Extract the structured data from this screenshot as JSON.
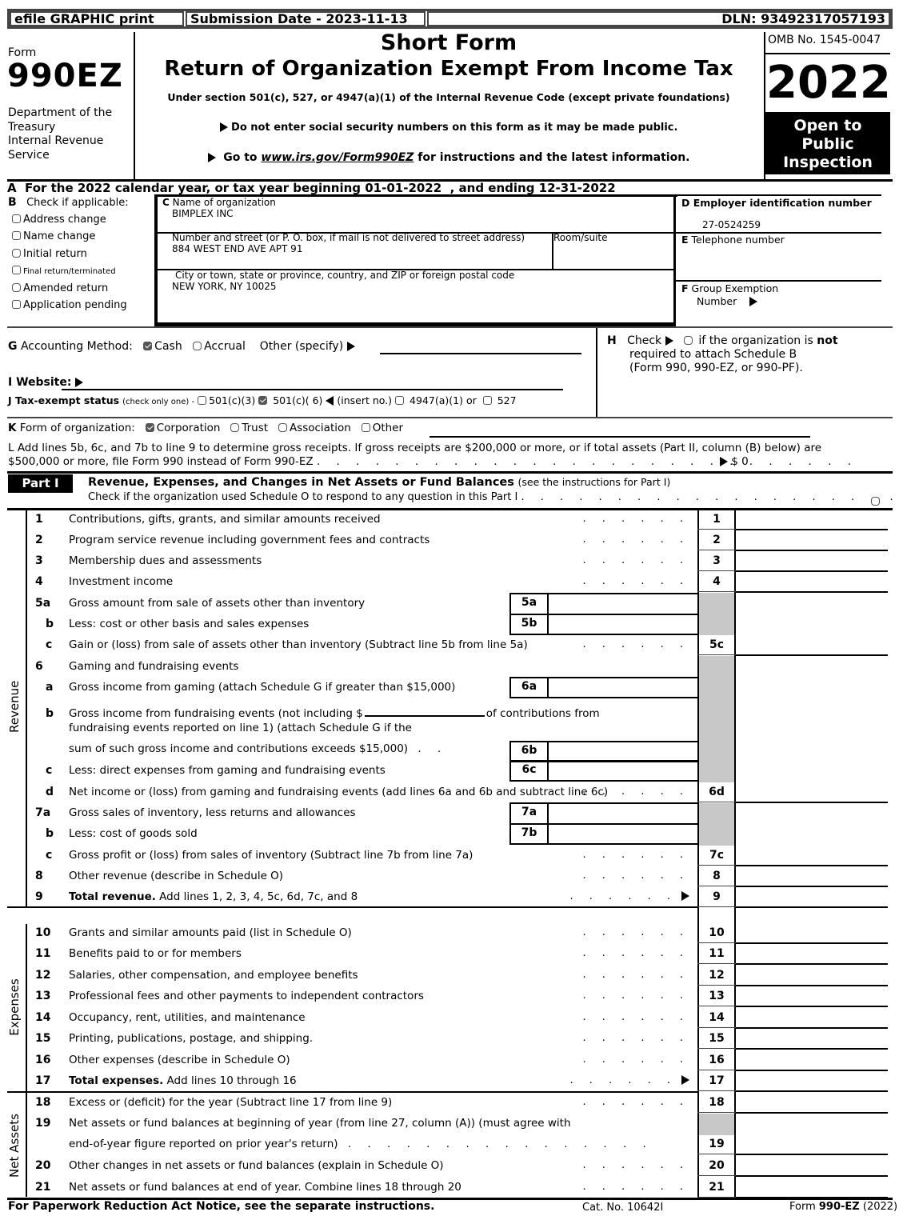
{
  "topbar": {
    "efile": "efile GRAPHIC print",
    "submission": "Submission Date - 2023-11-13",
    "dln": "DLN: 93492317057193"
  },
  "header": {
    "form_word": "Form",
    "form_number": "990EZ",
    "dept": [
      "Department of the",
      "Treasury",
      "Internal Revenue",
      "Service"
    ],
    "title1": "Short Form",
    "title2": "Return of Organization Exempt From Income Tax",
    "subtitle": "Under section 501(c), 527, or 4947(a)(1) of the Internal Revenue Code (except private foundations)",
    "ssn_notice": "Do not enter social security numbers on this form as it may be made public.",
    "goto_prefix": "Go to ",
    "goto_link": "www.irs.gov/Form990EZ",
    "goto_suffix": " for instructions and the latest information.",
    "omb": "OMB No. 1545-0047",
    "year": "2022",
    "open_public": [
      "Open to",
      "Public",
      "Inspection"
    ]
  },
  "section_a": "A  For the 2022 calendar year, or tax year beginning 01-01-2022  , and ending 12-31-2022",
  "section_b": {
    "letter": "B",
    "title": "Check if applicable:",
    "items": [
      {
        "label": "Address change",
        "checked": false
      },
      {
        "label": "Name change",
        "checked": false
      },
      {
        "label": "Initial return",
        "checked": false
      },
      {
        "label": "Final return/terminated",
        "checked": false
      },
      {
        "label": "Amended return",
        "checked": false
      },
      {
        "label": "Application pending",
        "checked": false
      }
    ]
  },
  "section_c": {
    "name_label_letter": "C",
    "name_label": "Name of organization",
    "name_value": "BIMPLEX INC",
    "street_label": "Number and street (or P. O. box, if mail is not delivered to street address)",
    "street_value": "884 WEST END AVE APT 91",
    "room_label": "Room/suite",
    "room_value": "",
    "city_label": "City or town, state or province, country, and ZIP or foreign postal code",
    "city_value": "NEW YORK, NY   10025"
  },
  "section_d": {
    "label": "D Employer identification number",
    "value": "27-0524259"
  },
  "section_e": {
    "letter": "E",
    "label": "Telephone number",
    "value": ""
  },
  "section_f": {
    "letter": "F",
    "label": "Group Exemption",
    "label2": "Number",
    "value": ""
  },
  "section_g": {
    "letter": "G",
    "label": "Accounting Method:",
    "options": [
      {
        "label": "Cash",
        "checked": true
      },
      {
        "label": "Accrual",
        "checked": false
      }
    ],
    "other_label": "Other (specify)",
    "other_value": ""
  },
  "section_h": {
    "letter": "H",
    "text1": "Check",
    "text2": "if the organization is",
    "text_bold": "not",
    "text3": "required to attach Schedule B",
    "text4": "(Form 990, 990-EZ, or 990-PF).",
    "checked": false
  },
  "section_i": {
    "label": "I Website:",
    "value": ""
  },
  "section_j": {
    "label": "J Tax-exempt status",
    "note": "(check only one) -",
    "options": [
      {
        "label": "501(c)(3)",
        "checked": false
      },
      {
        "label": "501(c)( 6)",
        "checked": true
      },
      {
        "label": "(insert no.)"
      },
      {
        "label": "4947(a)(1) or",
        "checked": false
      },
      {
        "label": "527",
        "checked": false
      }
    ]
  },
  "section_k": {
    "letter": "K",
    "label": "Form of organization:",
    "options": [
      {
        "label": "Corporation",
        "checked": true
      },
      {
        "label": "Trust",
        "checked": false
      },
      {
        "label": "Association",
        "checked": false
      },
      {
        "label": "Other",
        "checked": false
      }
    ]
  },
  "section_l": {
    "line1": "L Add lines 5b, 6c, and 7b to line 9 to determine gross receipts. If gross receipts are $200,000 or more, or if total assets (Part II, column (B) below) are",
    "line2": "$500,000 or more, file Form 990 instead of Form 990-EZ",
    "value": "$ 0"
  },
  "part1": {
    "badge": "Part I",
    "title": "Revenue, Expenses, and Changes in Net Assets or Fund Balances",
    "title_note": "(see the instructions for Part I)",
    "check_text": "Check if the organization used Schedule O to respond to any question in this Part I",
    "side_labels": {
      "revenue": "Revenue",
      "expenses": "Expenses",
      "net_assets": "Net Assets"
    },
    "lines": [
      {
        "num": "1",
        "text": "Contributions, gifts, grants, and similar amounts received",
        "box": "1",
        "value": ""
      },
      {
        "num": "2",
        "text": "Program service revenue including government fees and contracts",
        "box": "2",
        "value": ""
      },
      {
        "num": "3",
        "text": "Membership dues and assessments",
        "box": "3",
        "value": ""
      },
      {
        "num": "4",
        "text": "Investment income",
        "box": "4",
        "value": ""
      },
      {
        "num": "5a",
        "text": "Gross amount from sale of assets other than inventory",
        "box": "5a",
        "value": ""
      },
      {
        "num": "b",
        "text": "Less: cost or other basis and sales expenses",
        "box": "5b",
        "value": ""
      },
      {
        "num": "c",
        "text": "Gain or (loss) from sale of assets other than inventory (Subtract line 5b from line 5a)",
        "box": "5c",
        "value": ""
      },
      {
        "num": "6",
        "text": "Gaming and fundraising events"
      },
      {
        "num": "a",
        "text": "Gross income from gaming (attach Schedule G if greater than $15,000)",
        "box": "6a",
        "value": ""
      },
      {
        "num": "b",
        "text": "Gross income from fundraising events (not including $",
        "text_b": "of contributions from",
        "text2": "fundraising events reported on line 1) (attach Schedule G if the",
        "text3": "sum of such gross income and contributions exceeds $15,000)",
        "box": "6b",
        "value": ""
      },
      {
        "num": "c",
        "text": "Less: direct expenses from gaming and fundraising events",
        "box": "6c",
        "value": ""
      },
      {
        "num": "d",
        "text": "Net income or (loss) from gaming and fundraising events (add lines 6a and 6b and subtract line 6c)",
        "box": "6d",
        "value": ""
      },
      {
        "num": "7a",
        "text": "Gross sales of inventory, less returns and allowances",
        "box": "7a",
        "value": ""
      },
      {
        "num": "b",
        "text": "Less: cost of goods sold",
        "box": "7b",
        "value": ""
      },
      {
        "num": "c",
        "text": "Gross profit or (loss) from sales of inventory (Subtract line 7b from line 7a)",
        "box": "7c",
        "value": ""
      },
      {
        "num": "8",
        "text": "Other revenue (describe in Schedule O)",
        "box": "8",
        "value": ""
      },
      {
        "num": "9",
        "text_bold": "Total revenue.",
        "text": " Add lines 1, 2, 3, 4, 5c, 6d, 7c, and 8",
        "box": "9",
        "value": ""
      },
      {
        "num": "10",
        "text": "Grants and similar amounts paid (list in Schedule O)",
        "box": "10",
        "value": ""
      },
      {
        "num": "11",
        "text": "Benefits paid to or for members",
        "box": "11",
        "value": ""
      },
      {
        "num": "12",
        "text": "Salaries, other compensation, and employee benefits",
        "box": "12",
        "value": ""
      },
      {
        "num": "13",
        "text": "Professional fees and other payments to independent contractors",
        "box": "13",
        "value": ""
      },
      {
        "num": "14",
        "text": "Occupancy, rent, utilities, and maintenance",
        "box": "14",
        "value": ""
      },
      {
        "num": "15",
        "text": "Printing, publications, postage, and shipping.",
        "box": "15",
        "value": ""
      },
      {
        "num": "16",
        "text": "Other expenses (describe in Schedule O)",
        "box": "16",
        "value": ""
      },
      {
        "num": "17",
        "text_bold": "Total expenses.",
        "text": " Add lines 10 through 16",
        "box": "17",
        "value": ""
      },
      {
        "num": "18",
        "text": "Excess or (deficit) for the year (Subtract line 17 from line 9)",
        "box": "18",
        "value": ""
      },
      {
        "num": "19",
        "text": "Net assets or fund balances at beginning of year (from line 27, column (A)) (must agree with",
        "text2": "end-of-year figure reported on prior year's return)",
        "box": "19",
        "value": ""
      },
      {
        "num": "20",
        "text": "Other changes in net assets or fund balances (explain in Schedule O)",
        "box": "20",
        "value": ""
      },
      {
        "num": "21",
        "text": "Net assets or fund balances at end of year. Combine lines 18 through 20",
        "box": "21",
        "value": ""
      }
    ]
  },
  "footer": {
    "paperwork": "For Paperwork Reduction Act Notice, see the separate instructions.",
    "cat": "Cat. No. 10642I",
    "form_prefix": "Form ",
    "form_bold": "990-EZ",
    "form_suffix": " (2022)"
  },
  "colors": {
    "shade": "#c8c8c8",
    "line": "#000000",
    "topbar_border": "#444444"
  }
}
